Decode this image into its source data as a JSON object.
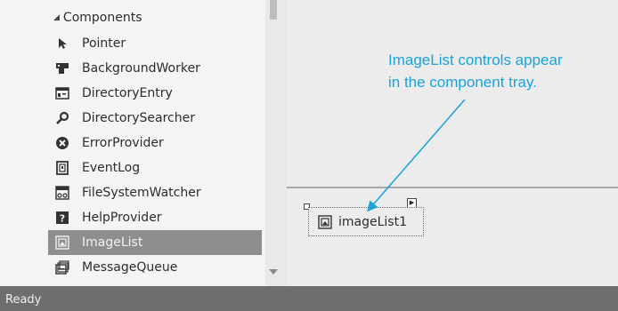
{
  "toolbox": {
    "category": "Components",
    "items": [
      {
        "label": "Pointer",
        "icon": "pointer-icon",
        "selected": false
      },
      {
        "label": "BackgroundWorker",
        "icon": "background-worker-icon",
        "selected": false
      },
      {
        "label": "DirectoryEntry",
        "icon": "directory-entry-icon",
        "selected": false
      },
      {
        "label": "DirectorySearcher",
        "icon": "magnifier-icon",
        "selected": false
      },
      {
        "label": "ErrorProvider",
        "icon": "error-icon",
        "selected": false
      },
      {
        "label": "EventLog",
        "icon": "event-log-icon",
        "selected": false
      },
      {
        "label": "FileSystemWatcher",
        "icon": "file-system-watcher-icon",
        "selected": false
      },
      {
        "label": "HelpProvider",
        "icon": "help-icon",
        "selected": false
      },
      {
        "label": "ImageList",
        "icon": "image-list-icon",
        "selected": true
      },
      {
        "label": "MessageQueue",
        "icon": "message-queue-icon",
        "selected": false
      }
    ]
  },
  "tray": {
    "component_label": "imageList1",
    "component_icon": "image-list-icon"
  },
  "callout": {
    "line1": "ImageList controls appear",
    "line2": "in the component tray.",
    "color": "#1aa3dc"
  },
  "status": {
    "text": "Ready"
  }
}
